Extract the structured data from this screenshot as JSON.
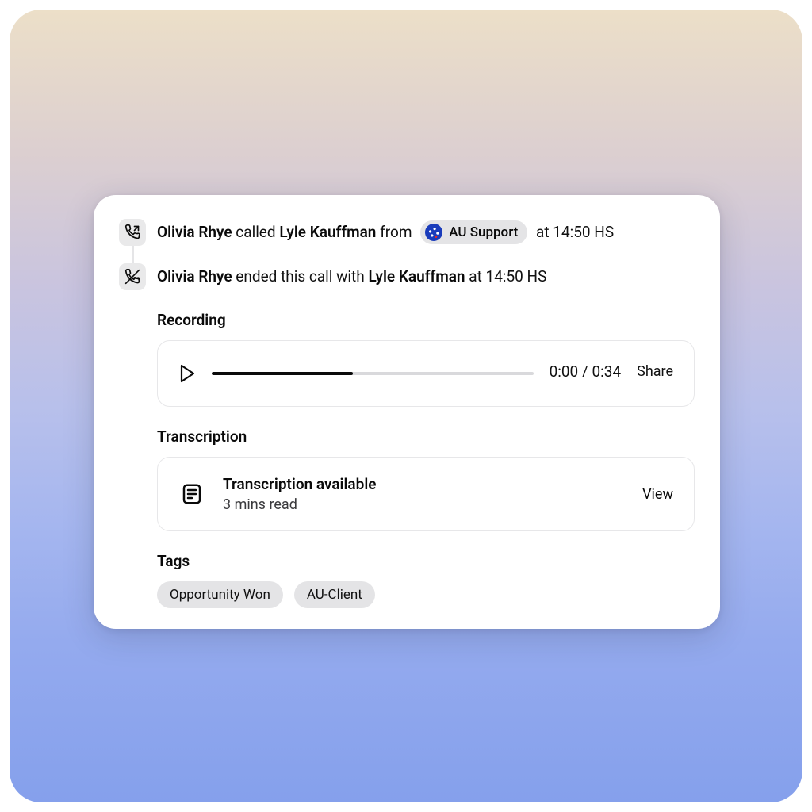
{
  "events": {
    "call_started": {
      "caller_name": "Olivia Rhye",
      "verb_called": " called ",
      "callee_name": "Lyle Kauffman",
      "from_word": " from ",
      "team_label": "AU Support",
      "at_word": " at ",
      "time": "14:50 HS"
    },
    "call_ended": {
      "caller_name": "Olivia Rhye",
      "verb_ended": " ended this call with ",
      "callee_name": "Lyle Kauffman",
      "at_word": " at ",
      "time": "14:50 HS"
    }
  },
  "recording": {
    "section_title": "Recording",
    "current_time": "0:00",
    "separator": " / ",
    "total_time": "0:34",
    "progress_percent": 44,
    "share_label": "Share"
  },
  "transcription": {
    "section_title": "Transcription",
    "status_title": "Transcription available",
    "read_time": "3 mins read",
    "view_label": "View"
  },
  "tags": {
    "section_title": "Tags",
    "items": [
      "Opportunity Won",
      "AU-Client"
    ]
  }
}
